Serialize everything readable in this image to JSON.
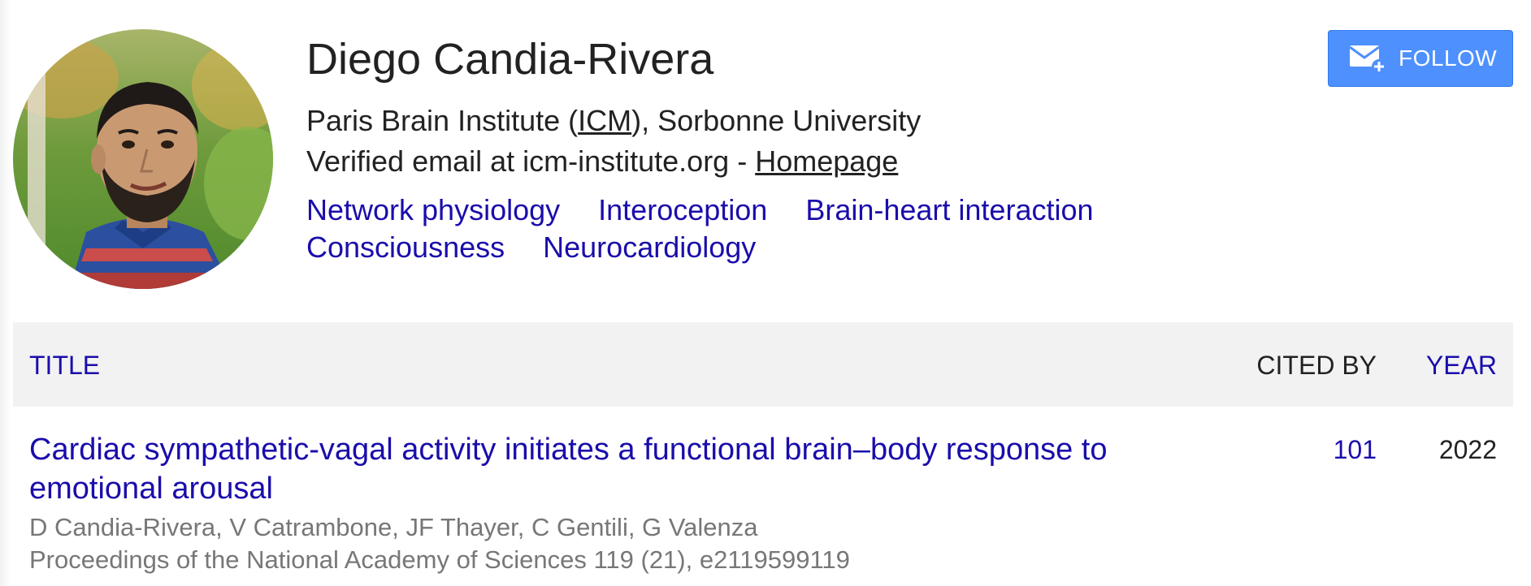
{
  "profile": {
    "name": "Diego Candia-Rivera",
    "affiliation_prefix": "Paris Brain Institute (",
    "affiliation_link": "ICM",
    "affiliation_suffix": "), Sorbonne University",
    "email_text": "Verified email at icm-institute.org - ",
    "homepage_link": "Homepage",
    "interests": [
      "Network physiology",
      "Interoception",
      "Brain-heart interaction",
      "Consciousness",
      "Neurocardiology"
    ]
  },
  "follow_button": {
    "label": "FOLLOW",
    "icon": "mail-plus-icon",
    "color": "#4d90fe"
  },
  "table": {
    "headers": {
      "title": "TITLE",
      "cited_by": "CITED BY",
      "year": "YEAR"
    },
    "rows": [
      {
        "title": "Cardiac sympathetic-vagal activity initiates a functional brain–body response to emotional arousal",
        "authors": "D Candia-Rivera, V Catrambone, JF Thayer, C Gentili, G Valenza",
        "venue": "Proceedings of the National Academy of Sciences 119 (21), e2119599119",
        "cited_by": "101",
        "year": "2022"
      }
    ]
  },
  "colors": {
    "link": "#1a0dab",
    "header_bg": "#f2f2f2",
    "meta_text": "#777777",
    "button_bg": "#4d90fe"
  }
}
